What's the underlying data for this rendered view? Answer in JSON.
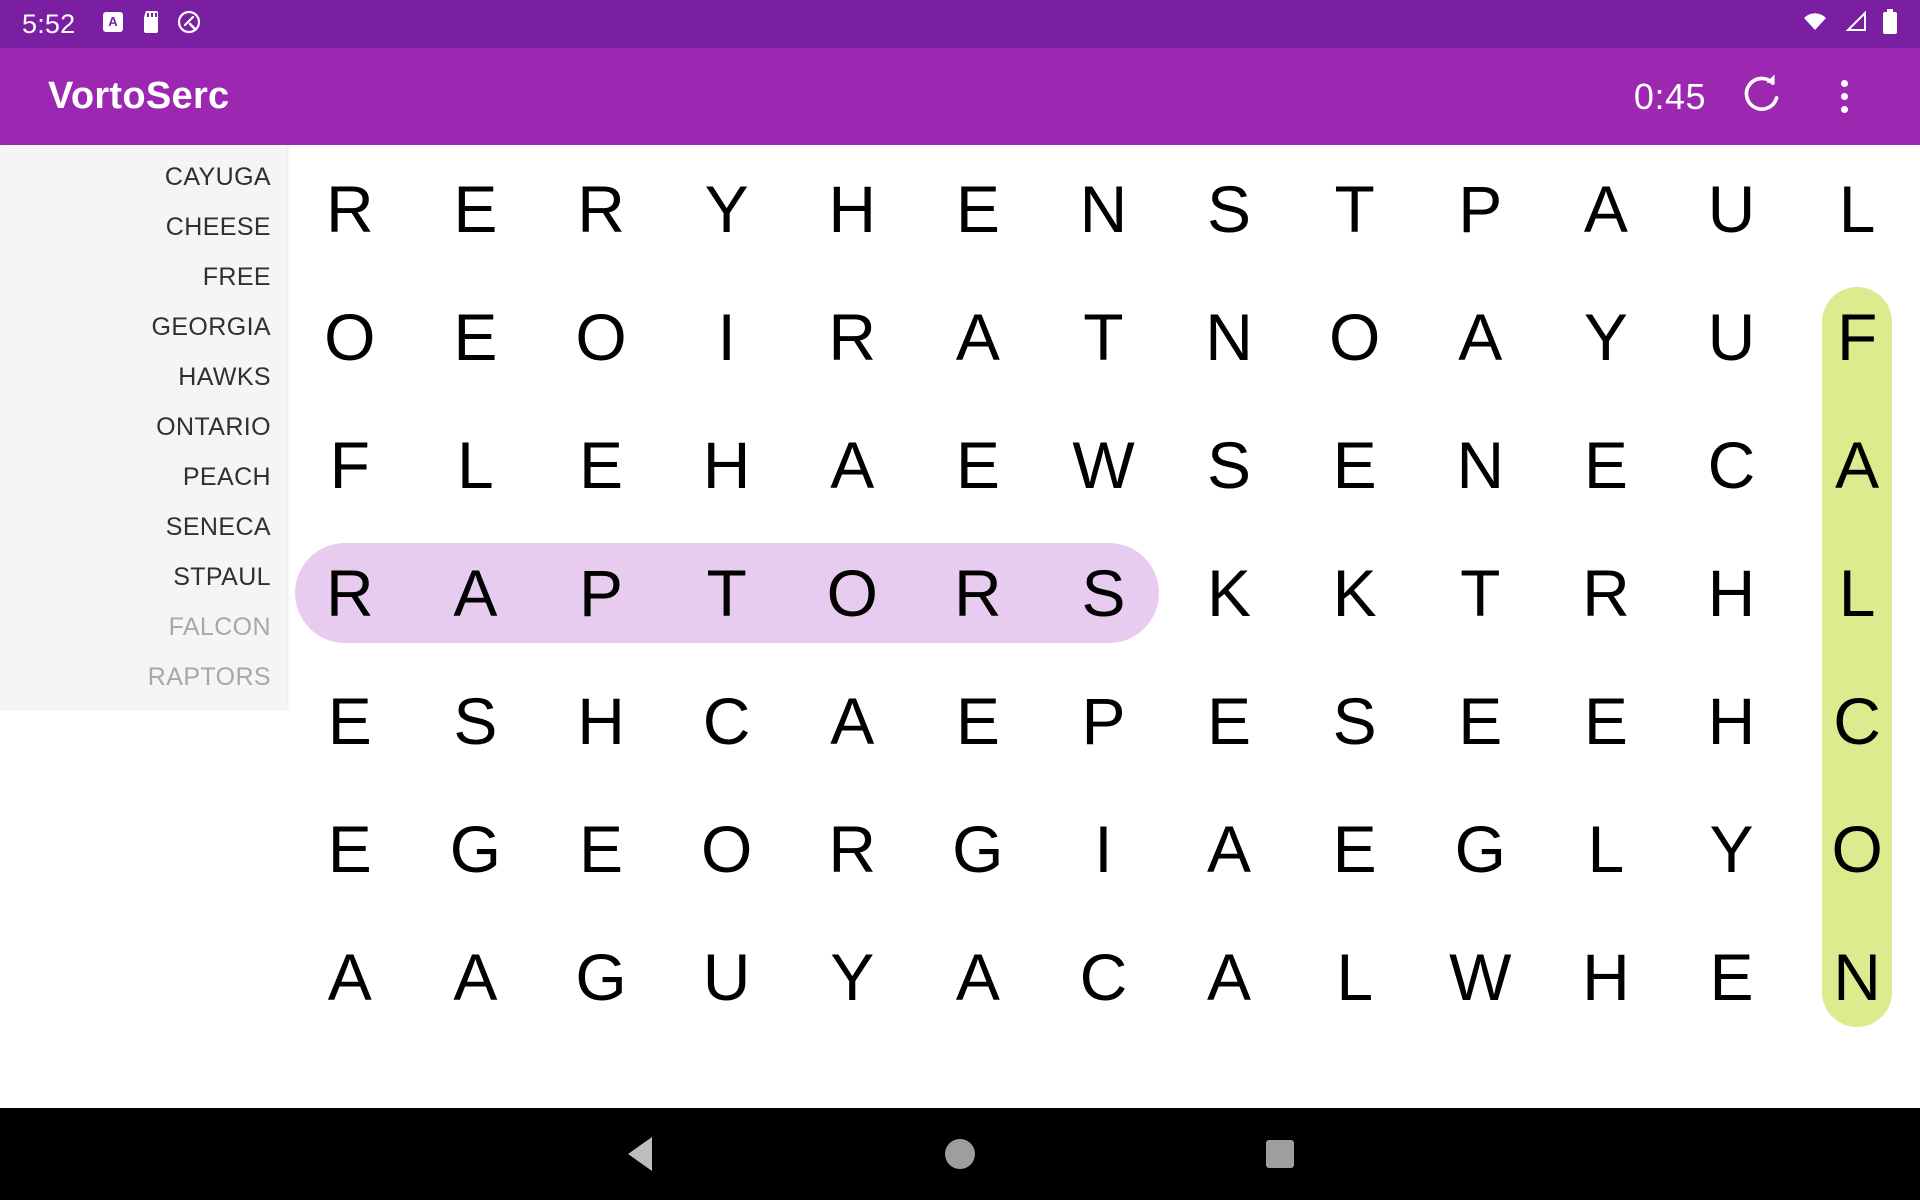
{
  "status_bar": {
    "clock": "5:52",
    "icons": [
      "screenshot-icon",
      "sd-card-icon",
      "android-q-icon",
      "wifi-icon",
      "signal-icon",
      "battery-icon"
    ]
  },
  "app_bar": {
    "title": "VortoSerc",
    "timer": "0:45",
    "refresh_icon": "refresh-icon",
    "overflow_icon": "overflow-menu-icon"
  },
  "word_list": {
    "items": [
      {
        "label": "CAYUGA",
        "found": false
      },
      {
        "label": "CHEESE",
        "found": false
      },
      {
        "label": "FREE",
        "found": false
      },
      {
        "label": "GEORGIA",
        "found": false
      },
      {
        "label": "HAWKS",
        "found": false
      },
      {
        "label": "ONTARIO",
        "found": false
      },
      {
        "label": "PEACH",
        "found": false
      },
      {
        "label": "SENECA",
        "found": false
      },
      {
        "label": "STPAUL",
        "found": false
      },
      {
        "label": "FALCON",
        "found": true
      },
      {
        "label": "RAPTORS",
        "found": true
      }
    ]
  },
  "grid": {
    "columns": 13,
    "rows": [
      [
        "R",
        "E",
        "R",
        "Y",
        "H",
        "E",
        "N",
        "S",
        "T",
        "P",
        "A",
        "U",
        "L"
      ],
      [
        "O",
        "E",
        "O",
        "I",
        "R",
        "A",
        "T",
        "N",
        "O",
        "A",
        "Y",
        "U",
        "F"
      ],
      [
        "F",
        "L",
        "E",
        "H",
        "A",
        "E",
        "W",
        "S",
        "E",
        "N",
        "E",
        "C",
        "A"
      ],
      [
        "R",
        "A",
        "P",
        "T",
        "O",
        "R",
        "S",
        "K",
        "K",
        "T",
        "R",
        "H",
        "L"
      ],
      [
        "E",
        "S",
        "H",
        "C",
        "A",
        "E",
        "P",
        "E",
        "S",
        "E",
        "E",
        "H",
        "C"
      ],
      [
        "E",
        "G",
        "E",
        "O",
        "R",
        "G",
        "I",
        "A",
        "E",
        "G",
        "L",
        "Y",
        "O"
      ],
      [
        "A",
        "A",
        "G",
        "U",
        "Y",
        "A",
        "C",
        "A",
        "L",
        "W",
        "H",
        "E",
        "N"
      ]
    ],
    "highlights": [
      {
        "word": "RAPTORS",
        "color": "#E8CCEF",
        "orientation": "horizontal",
        "row": 3,
        "col_start": 0,
        "col_end": 6
      },
      {
        "word": "FALCON",
        "color": "#DDEB8E",
        "orientation": "vertical",
        "col": 12,
        "row_start": 1,
        "row_end": 6
      }
    ]
  },
  "nav_bar": {
    "back_label": "back-button",
    "home_label": "home-button",
    "recents_label": "recents-button"
  },
  "colors": {
    "status_bar": "#7B1FA2",
    "app_bar": "#9C27B0",
    "panel_bg": "#f5f5f5",
    "found_word_text": "#a8a8a8",
    "word_text": "#303030",
    "raptors_highlight": "#E8CCEF",
    "falcon_highlight": "#DDEB8E"
  }
}
